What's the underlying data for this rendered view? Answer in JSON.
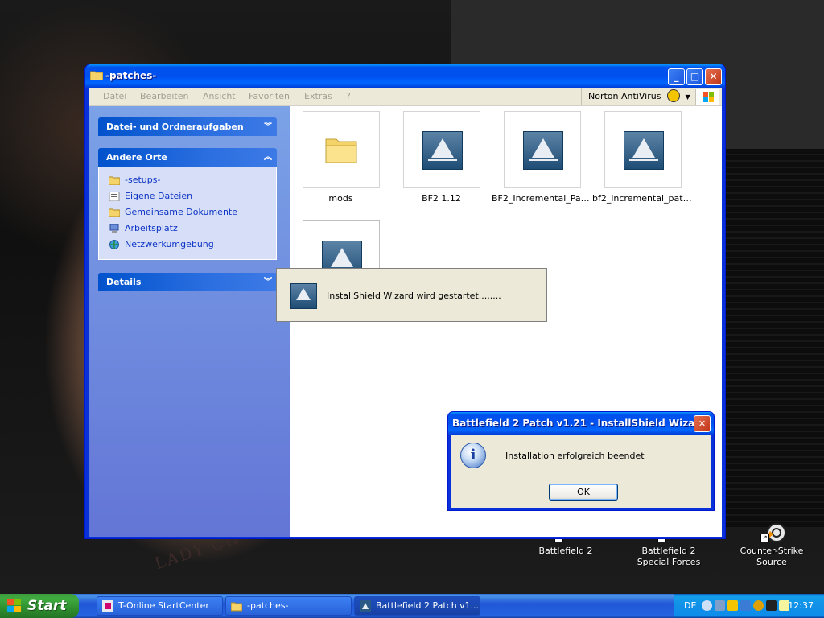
{
  "window": {
    "title": "-patches-",
    "menu": [
      "Datei",
      "Bearbeiten",
      "Ansicht",
      "Favoriten",
      "Extras",
      "?"
    ],
    "norton_label": "Norton AntiVirus"
  },
  "sidebar": {
    "file_tasks_header": "Datei- und Ordneraufgaben",
    "other_places_header": "Andere Orte",
    "other_places": [
      {
        "label": "-setups-",
        "icon": "folder-icon"
      },
      {
        "label": "Eigene Dateien",
        "icon": "my-documents-icon"
      },
      {
        "label": "Gemeinsame Dokumente",
        "icon": "folder-icon"
      },
      {
        "label": "Arbeitsplatz",
        "icon": "computer-icon"
      },
      {
        "label": "Netzwerkumgebung",
        "icon": "network-icon"
      }
    ],
    "details_header": "Details"
  },
  "files": [
    {
      "name": "mods",
      "type": "folder"
    },
    {
      "name": "BF2 1.12",
      "type": "installer"
    },
    {
      "name": "BF2_Incremental_Patc...",
      "type": "installer"
    },
    {
      "name": "bf2_incremental_patc...",
      "type": "installer"
    },
    {
      "name": "",
      "type": "installer"
    }
  ],
  "launcher": {
    "text": "InstallShield Wizard wird gestartet........"
  },
  "message_box": {
    "title": "Battlefield 2 Patch v1.21 - InstallShield Wizard",
    "text": "Installation erfolgreich beendet",
    "ok_label": "OK"
  },
  "desktop_icons": [
    {
      "label": "Battlefield 2"
    },
    {
      "label": "Battlefield 2 Special Forces"
    },
    {
      "label": "Counter-Strike Source"
    }
  ],
  "desktop": {
    "tattoo_text": "LADY CH"
  },
  "taskbar": {
    "start_label": "Start",
    "items": [
      {
        "label": "T-Online StartCenter"
      },
      {
        "label": "-patches-"
      },
      {
        "label": "Battlefield 2 Patch v1..."
      }
    ],
    "language": "DE",
    "clock": "12:37"
  }
}
